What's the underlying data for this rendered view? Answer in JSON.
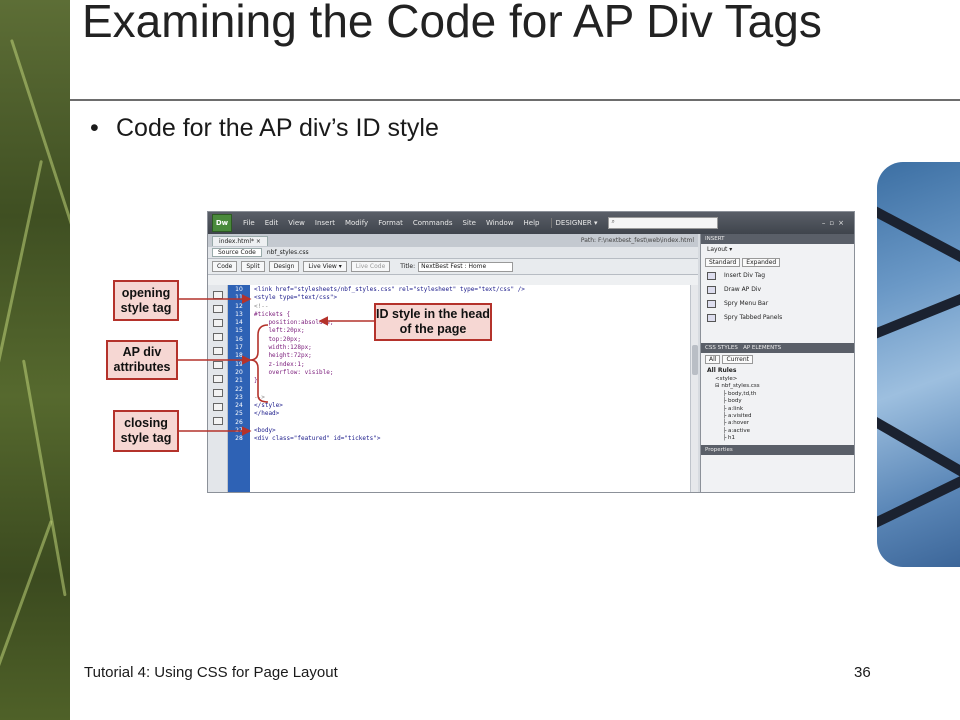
{
  "slide": {
    "title": "Examining the Code for AP Div Tags",
    "bullet": "Code for the AP div’s ID style",
    "footer_left": "Tutorial 4: Using CSS for Page Layout",
    "page_number": "36"
  },
  "dreamweaver": {
    "logo": "Dw",
    "menus": [
      "File",
      "Edit",
      "View",
      "Insert",
      "Modify",
      "Format",
      "Commands",
      "Site",
      "Window",
      "Help"
    ],
    "workspace": "DESIGNER ▾",
    "document_tab": "index.html*  ×",
    "path": "Path: F:\\nextbest_fest\\web\\index.html",
    "related_files": [
      "Source Code",
      "nbf_styles.css"
    ],
    "view_buttons": [
      "Code",
      "Split",
      "Design",
      "Live View ▾",
      "Live Code"
    ],
    "title_label": "Title:",
    "title_value": "NextBest Fest : Home",
    "line_numbers": [
      "10",
      "11",
      "12",
      "13",
      "14",
      "15",
      "16",
      "17",
      "18",
      "19",
      "20",
      "21",
      "22",
      "23",
      "24",
      "25",
      "26",
      "27",
      "28"
    ],
    "code_lines": [
      "<link href=\"stylesheets/nbf_styles.css\" rel=\"stylesheet\" type=\"text/css\" />",
      "<style type=\"text/css\">",
      "<!--",
      "#tickets {",
      "    position:absolute;",
      "    left:20px;",
      "    top:20px;",
      "    width:128px;",
      "    height:72px;",
      "    z-index:1;",
      "    overflow: visible;",
      "}",
      "",
      "-->",
      "</style>",
      "</head>",
      "",
      "<body>",
      "<div class=\"featured\" id=\"tickets\">"
    ],
    "insert_panel": {
      "header": "INSERT",
      "category": "Layout ▾",
      "modes": [
        "Standard",
        "Expanded"
      ],
      "items": [
        "Insert Div Tag",
        "Draw AP Div",
        "Spry Menu Bar",
        "Spry Tabbed Panels"
      ]
    },
    "css_panel": {
      "tabs": [
        "CSS STYLES",
        "AP ELEMENTS"
      ],
      "modes": [
        "All",
        "Current"
      ],
      "heading": "All Rules",
      "rules": [
        "<style>",
        "nbf_styles.css",
        "body,td,th",
        "body",
        "a:link",
        "a:visited",
        "a:hover",
        "a:active",
        "h1"
      ],
      "footer": "Properties"
    }
  },
  "callouts": {
    "opening": "opening style tag",
    "id_style": "ID style in the head of the page",
    "ap_attributes": "AP div attributes",
    "closing": "closing style tag"
  },
  "colors": {
    "callout_fill": "#f6d7d3",
    "callout_border": "#b4322b",
    "line_number_bg": "#2e62b5"
  }
}
